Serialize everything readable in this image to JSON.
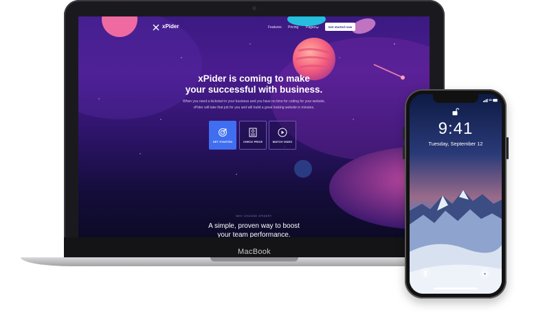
{
  "laptop": {
    "brand_label": "MacBook",
    "website": {
      "logo_text": "xPider",
      "nav_links": [
        "Features",
        "Pricing",
        "Pages"
      ],
      "nav_cta": "Get started now",
      "hero_title_line1": "xPider is coming to make",
      "hero_title_line2": "your successful with business.",
      "hero_sub_line1": "When you need a kickstart in your business and you have no time for coding for your website,",
      "hero_sub_line2": "xPider will take that job for you and will build a great looking website in minutes.",
      "cards": [
        {
          "label": "GET STARTED",
          "icon": "rocket-target-icon"
        },
        {
          "label": "CHECK PRICE",
          "icon": "receipt-icon"
        },
        {
          "label": "WATCH VIDEO",
          "icon": "play-icon"
        }
      ],
      "section_eyebrow": "WHY CHOOSE XPIDER?",
      "section_title_line1": "A simple, proven way to boost",
      "section_title_line2": "your team performance."
    }
  },
  "phone": {
    "time": "9:41",
    "date": "Tuesday, September 12",
    "icons": [
      "lock-icon",
      "flashlight-icon",
      "camera-icon",
      "signal-icon",
      "wifi-icon",
      "battery-icon"
    ]
  },
  "colors": {
    "accent_blue": "#3f6ef0",
    "hero_bg_top": "#4a1c8f",
    "hero_bg_bottom": "#0d0a26",
    "planet_pink": "#ff6b8e"
  }
}
